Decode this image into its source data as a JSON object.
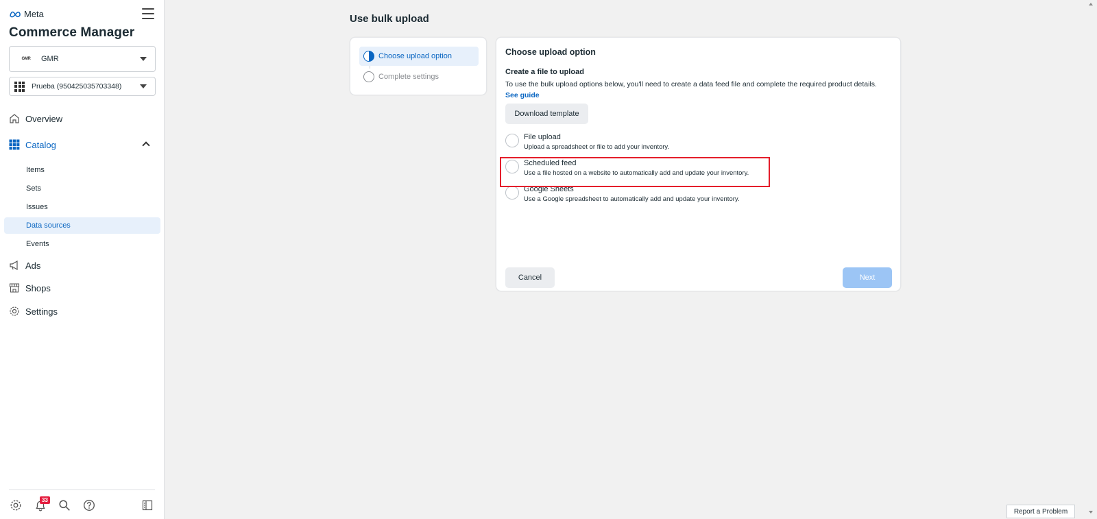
{
  "sidebar": {
    "brand": "Meta",
    "app_title": "Commerce Manager",
    "business": {
      "logo_text": "GMR",
      "name": "GMR"
    },
    "catalog": {
      "name": "Prueba (950425035703348)"
    },
    "nav": {
      "overview": "Overview",
      "catalog": "Catalog",
      "ads": "Ads",
      "shops": "Shops",
      "settings": "Settings"
    },
    "catalog_items": {
      "items": "Items",
      "sets": "Sets",
      "issues": "Issues",
      "data_sources": "Data sources",
      "events": "Events"
    },
    "notifications_count": "33"
  },
  "main": {
    "page_title": "Use bulk upload",
    "steps": {
      "current": "Choose upload option",
      "pending": "Complete settings"
    },
    "card": {
      "title": "Choose upload option",
      "subtitle": "Create a file to upload",
      "description": "To use the bulk upload options below, you'll need to create a data feed file and complete the required product details.",
      "guide_link": "See guide",
      "download_button": "Download template",
      "options": [
        {
          "title": "File upload",
          "desc": "Upload a spreadsheet or file to add your inventory."
        },
        {
          "title": "Scheduled feed",
          "desc": "Use a file hosted on a website to automatically add and update your inventory."
        },
        {
          "title": "Google Sheets",
          "desc": "Use a Google spreadsheet to automatically add and update your inventory."
        }
      ],
      "cancel_button": "Cancel",
      "next_button": "Next"
    },
    "report_button": "Report a Problem"
  },
  "colors": {
    "accent": "#0a66c2",
    "highlight": "#e41e2b",
    "next_disabled": "#9cc5f5"
  }
}
